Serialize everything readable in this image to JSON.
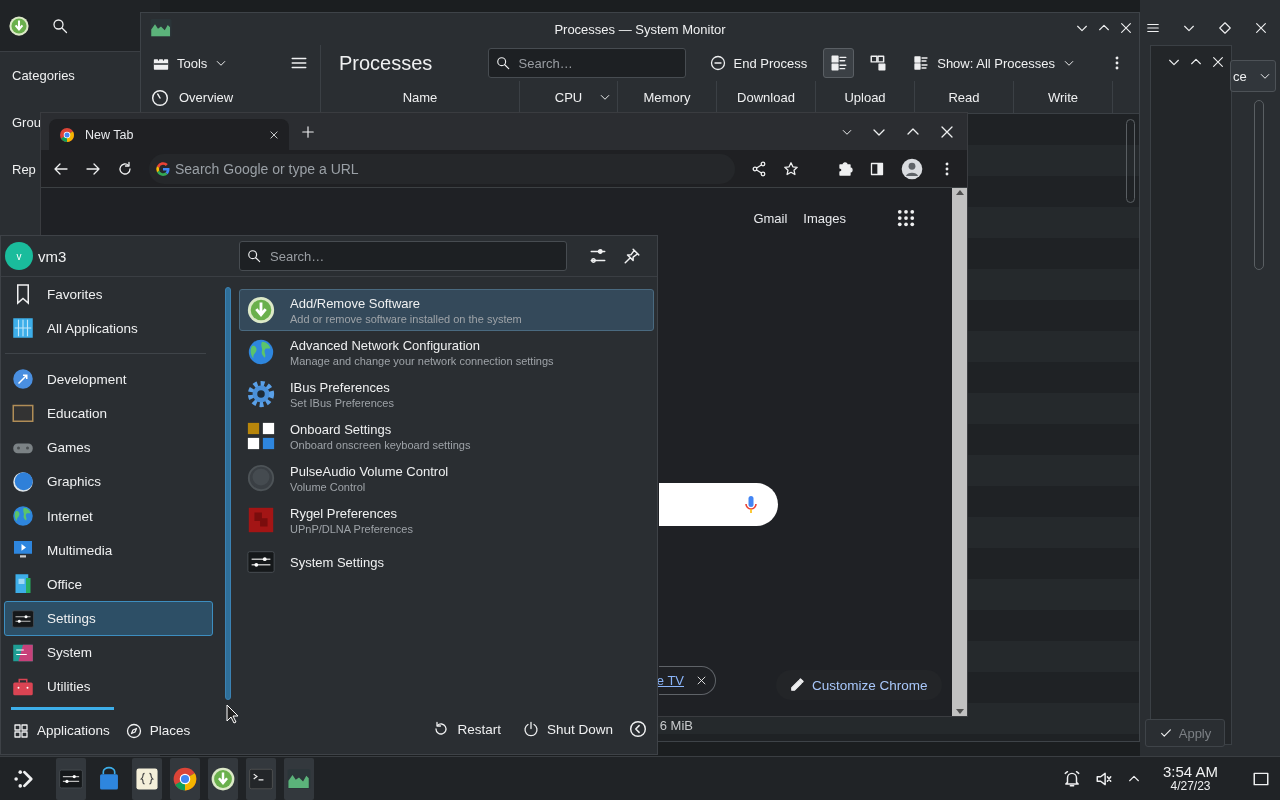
{
  "background_app": {
    "sidebar_items": [
      "Categories",
      "Grou",
      "Rep"
    ]
  },
  "background_window": {
    "dropdown_value": "ce",
    "apply_button": "Apply"
  },
  "system_monitor": {
    "title": "Processes — System Monitor",
    "tools_button": "Tools",
    "sidebar_items": [
      "Overview"
    ],
    "page_title": "Processes",
    "search": {
      "placeholder": "Search…"
    },
    "end_process_button": "End Process",
    "view_buttons": [
      {
        "selected": true
      },
      {
        "selected": false
      }
    ],
    "show_filter": "Show: All Processes",
    "columns": [
      "Name",
      "CPU",
      "Memory",
      "Download",
      "Upload",
      "Read",
      "Write"
    ],
    "memory_cell": "6 MiB"
  },
  "browser": {
    "tabs": [
      {
        "label": "New Tab",
        "selected": true
      }
    ],
    "address_bar": {
      "placeholder": "Search Google or type a URL"
    },
    "header_links": [
      "Gmail",
      "Images"
    ],
    "shortcut_chip": "e TV",
    "customize_button": "Customize Chrome"
  },
  "launcher": {
    "user": {
      "initial": "v",
      "name": "vm3"
    },
    "search": {
      "placeholder": "Search…"
    },
    "top_categories": [
      {
        "label": "Favorites",
        "kind": "bookmark",
        "selected": false
      },
      {
        "label": "All Applications",
        "kind": "grid",
        "selected": false
      }
    ],
    "categories": [
      {
        "label": "Development",
        "kind": "development",
        "selected": false
      },
      {
        "label": "Education",
        "kind": "education",
        "selected": false
      },
      {
        "label": "Games",
        "kind": "games",
        "selected": false
      },
      {
        "label": "Graphics",
        "kind": "graphics",
        "selected": false
      },
      {
        "label": "Internet",
        "kind": "globe",
        "selected": false
      },
      {
        "label": "Multimedia",
        "kind": "multimedia",
        "selected": false
      },
      {
        "label": "Office",
        "kind": "office",
        "selected": false
      },
      {
        "label": "Settings",
        "kind": "sliders",
        "selected": true
      },
      {
        "label": "System",
        "kind": "system",
        "selected": false
      },
      {
        "label": "Utilities",
        "kind": "utilities",
        "selected": false
      }
    ],
    "apps": [
      {
        "name": "Add/Remove Software",
        "description": "Add or remove software installed on the system",
        "kind": "download",
        "selected": true
      },
      {
        "name": "Advanced Network Configuration",
        "description": "Manage and change your network connection settings",
        "kind": "globe",
        "selected": false
      },
      {
        "name": "IBus Preferences",
        "description": "Set IBus Preferences",
        "kind": "gear",
        "selected": false
      },
      {
        "name": "Onboard Settings",
        "description": "Onboard onscreen keyboard settings",
        "kind": "onboard",
        "selected": false
      },
      {
        "name": "PulseAudio Volume Control",
        "description": "Volume Control",
        "kind": "knob",
        "selected": false
      },
      {
        "name": "Rygel Preferences",
        "description": "UPnP/DLNA Preferences",
        "kind": "rygel",
        "selected": false
      },
      {
        "name": "System Settings",
        "kind": "sliders",
        "selected": false
      }
    ],
    "tabs": [
      {
        "label": "Applications",
        "kind": "apps",
        "selected": true
      },
      {
        "label": "Places",
        "kind": "compass",
        "selected": false
      }
    ],
    "actions": [
      {
        "label": "Restart",
        "kind": "restart"
      },
      {
        "label": "Shut Down",
        "kind": "power"
      }
    ]
  },
  "taskbar": {
    "tasks": [
      {
        "kind": "sliders",
        "open": true
      },
      {
        "kind": "bag",
        "open": false
      },
      {
        "kind": "braces",
        "open": true
      },
      {
        "kind": "chrome",
        "open": true
      },
      {
        "kind": "download",
        "open": true
      },
      {
        "kind": "terminal",
        "open": true
      },
      {
        "kind": "monitor",
        "open": true
      }
    ],
    "clock": {
      "time": "3:54 AM",
      "date": "4/27/23"
    }
  }
}
